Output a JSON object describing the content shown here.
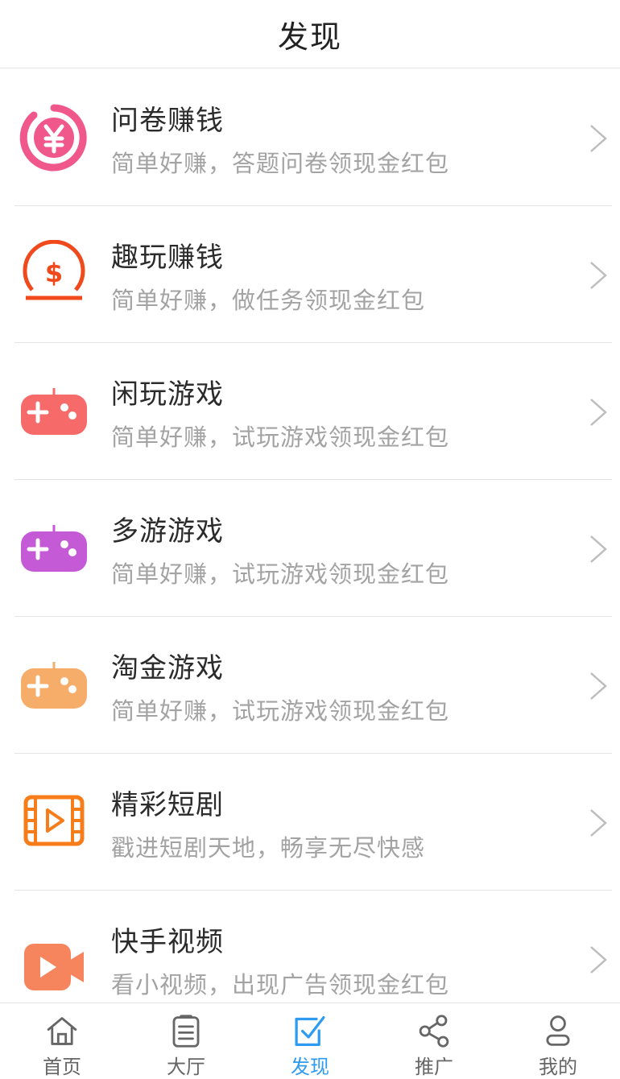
{
  "header": {
    "title": "发现"
  },
  "items": [
    {
      "title": "问卷赚钱",
      "subtitle": "简单好赚，答题问卷领现金红包",
      "icon": "yuan-coin-icon",
      "color": "#f0578a"
    },
    {
      "title": "趣玩赚钱",
      "subtitle": "简单好赚，做任务领现金红包",
      "icon": "dollar-coin-icon",
      "color": "#f04a1c"
    },
    {
      "title": "闲玩游戏",
      "subtitle": "简单好赚，试玩游戏领现金红包",
      "icon": "gamepad-icon",
      "color": "#f76a6a"
    },
    {
      "title": "多游游戏",
      "subtitle": "简单好赚，试玩游戏领现金红包",
      "icon": "gamepad-icon",
      "color": "#c45ad6"
    },
    {
      "title": "淘金游戏",
      "subtitle": "简单好赚，试玩游戏领现金红包",
      "icon": "gamepad-icon",
      "color": "#f6ad6a"
    },
    {
      "title": "精彩短剧",
      "subtitle": "戳进短剧天地，畅享无尽快感",
      "icon": "film-play-icon",
      "color": "#f77c1a"
    },
    {
      "title": "快手视频",
      "subtitle": "看小视频，出现广告领现金红包",
      "icon": "video-camera-icon",
      "color": "#f6855e"
    }
  ],
  "tabbar": {
    "active_color": "#2f9bf0",
    "inactive_color": "#666666",
    "tabs": [
      {
        "label": "首页",
        "icon": "home-icon"
      },
      {
        "label": "大厅",
        "icon": "clipboard-icon"
      },
      {
        "label": "发现",
        "icon": "check-square-icon",
        "active": true
      },
      {
        "label": "推广",
        "icon": "share-icon"
      },
      {
        "label": "我的",
        "icon": "user-icon"
      }
    ]
  }
}
